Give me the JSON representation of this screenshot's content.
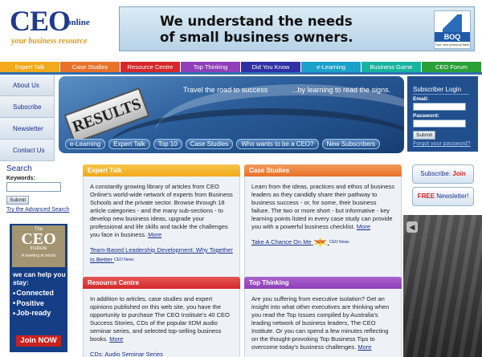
{
  "header": {
    "logo_main": "CEO",
    "logo_online": "online",
    "logo_tagline": "your business resource",
    "banner_text_line1": "We understand the needs",
    "banner_text_line2": "of small business owners.",
    "banner_brand": "BOQ",
    "banner_brand_sub": "Your own personal bank"
  },
  "nav": [
    {
      "label": "Expert Talk",
      "color": "#f2a91c"
    },
    {
      "label": "Case Studies",
      "color": "#e8712a"
    },
    {
      "label": "Resource Centre",
      "color": "#d4282b"
    },
    {
      "label": "Top Thinking",
      "color": "#8f3fb8"
    },
    {
      "label": "Did You Know",
      "color": "#2f2fa6"
    },
    {
      "label": "e-Learning",
      "color": "#1aa1c9"
    },
    {
      "label": "Business Game",
      "color": "#18b3a0"
    },
    {
      "label": "CEO Forum",
      "color": "#2aa036"
    }
  ],
  "side_menu": [
    "About Us",
    "Subscribe",
    "Newsletter",
    "Contact Us"
  ],
  "search": {
    "title": "Search",
    "keywords_label": "Keywords:",
    "submit_label": "Submit",
    "advanced_link": "Try the Advanced Search"
  },
  "ceo_ad": {
    "the": "The",
    "ceo": "CEO",
    "institute": "Institute",
    "mind": "A meeting of minds",
    "help": "we can help you stay:",
    "items": [
      "Connected",
      "Positive",
      "Job-ready"
    ],
    "join": "Join NOW"
  },
  "hero": {
    "tagline1": "Travel the road to success",
    "tagline2": "...by learning to read the signs.",
    "sign": "RESULTS",
    "tabs": [
      "e-Learning",
      "Expert Talk",
      "Top 10",
      "Case Studies",
      "Who wants to be a CEO?",
      "New Subscribers"
    ]
  },
  "subscriber": {
    "title": "Subscriber Login",
    "email_label": "Email:",
    "password_label": "Password:",
    "submit_label": "Submit",
    "forgot_link": "Forgot your password?"
  },
  "right": {
    "subscribe_prefix": "Subscribe:",
    "subscribe_action": "Join Now!",
    "newsletter_prefix": "FREE",
    "newsletter_suffix": "Newsletter!"
  },
  "boxes": {
    "expert_talk": {
      "title": "Expert Talk",
      "color": "#f2a91c",
      "body": "A constantly growing library of articles from CEO Online's world-wide network of experts from Business Schools and the private sector. Browse through 18 article categories - and the many sub-sections - to develop new business ideas, upgrade your professional and life skills and tackle the challenges you face in business.",
      "more": "More",
      "link": "Team-Based Leadership Development: Why Together Is Better",
      "badge": "CEO News"
    },
    "case_studies": {
      "title": "Case Studies",
      "color": "#e8712a",
      "body": "Learn from the ideas, practices and ethos of business leaders as they candidly share their pathway to business success - or, for some, their business failure. The two or more short - but informative - key learning points listed in every case study can provide you with a powerful business checklist.",
      "more": "More",
      "link": "Take A Chance On Me",
      "new": "NEW!",
      "badge": "CEO News"
    },
    "resource_centre": {
      "title": "Resource Centre",
      "color": "#d4282b",
      "body": "In addition to articles, case studies and expert opinions published on this web site, you have the opportunity to purchase The CEO Institute's 40 CEO Success Stories, CDs of the popular IIDM audio seminar series, and selected top-selling business books.",
      "more": "More",
      "link": "CDs: Audio Seminar Series"
    },
    "top_thinking": {
      "title": "Top Thinking",
      "color": "#8f3fb8",
      "body": "Are you suffering from executive isolation? Get an insight into what other executives are thinking when you read the Top Issues compiled by Australia's leading network of business leaders, The CEO Institute. Or you can spend a few minutes reflecting on the thought-provoking Top Business Tips to overcome today's business challenges.",
      "more": "More"
    }
  }
}
